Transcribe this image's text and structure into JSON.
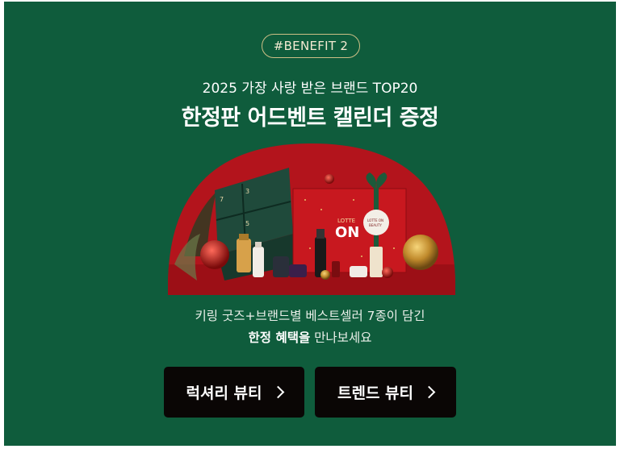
{
  "banner": {
    "badge": "#BENEFIT 2",
    "subtitle": "2025 가장 사랑 받은 브랜드  TOP20",
    "title": "한정판 어드벤트 캘린더 증정",
    "desc_line1": "키링 굿즈+브랜드별 베스트셀러 7종이 담긴",
    "desc_highlight": "한정 혜택을",
    "desc_line2_rest": " 만나보세요",
    "image_text": {
      "brand_top": "LOTTE",
      "brand_logo": "ON",
      "tag_line1": "LOTTE ON",
      "tag_line2": "BEAUTY"
    },
    "colors": {
      "background": "#0f5c3c",
      "badge_border": "#cdbf86",
      "button_bg": "#0a0605",
      "visual_red": "#b3141c"
    }
  },
  "buttons": {
    "luxury": "럭셔리 뷰티",
    "trend": "트렌드 뷰티"
  }
}
